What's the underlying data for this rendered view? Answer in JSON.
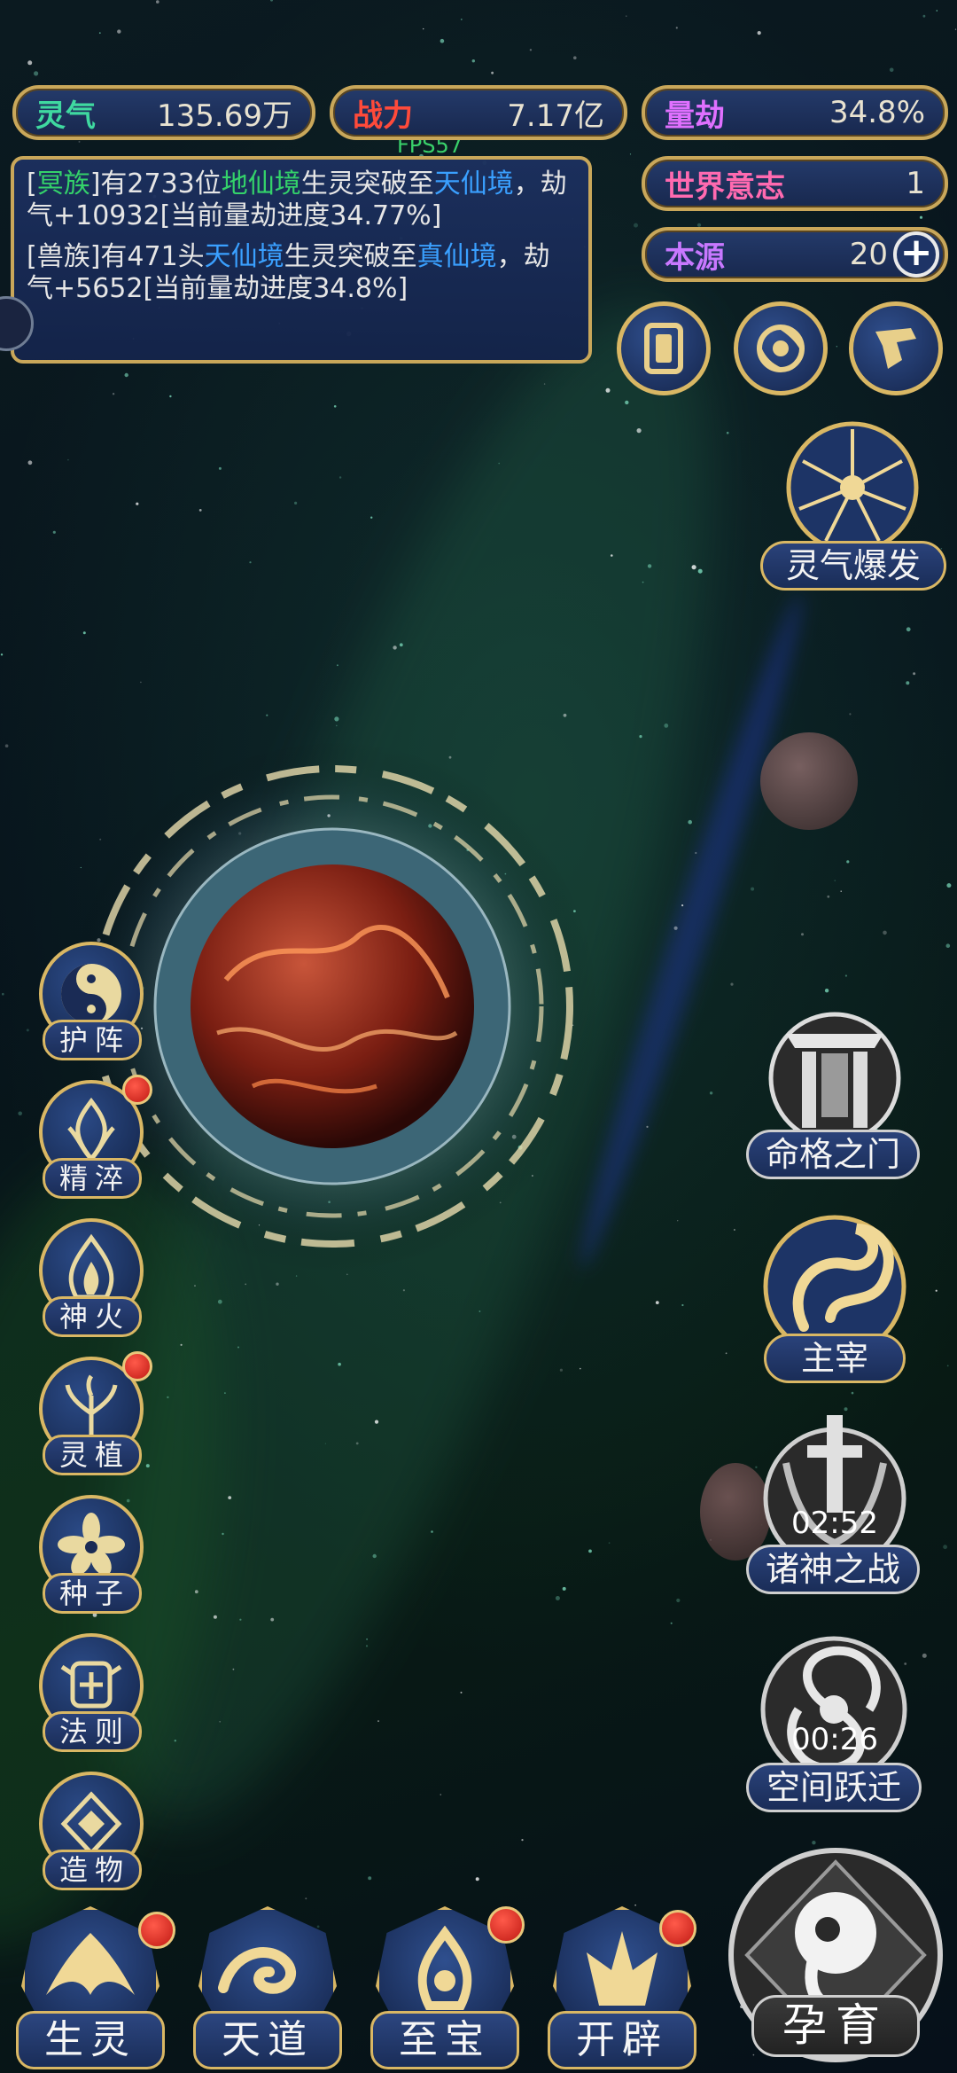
{
  "fps": "FPS57",
  "stats": {
    "lingqi": {
      "label": "灵气",
      "value": "135.69万"
    },
    "zhanli": {
      "label": "战力",
      "value": "7.17亿"
    },
    "liangjie": {
      "label": "量劫",
      "value": "34.8%"
    },
    "shijie": {
      "label": "世界意志",
      "value": "1"
    },
    "benyuan": {
      "label": "本源",
      "value": "20",
      "add": "+"
    }
  },
  "messages": [
    {
      "p1": "[",
      "race": "冥族",
      "p2": "]有2733位",
      "from": "地仙境",
      "p3": "生灵突破至",
      "to": "天仙境",
      "p4": "，劫气+10932[当前量劫进度34.77%]"
    },
    {
      "p1": "[兽族]有471头",
      "from": "天仙境",
      "p3": "生灵突破至",
      "to": "真仙境",
      "p4": "，劫气+5652[当前量劫进度34.8%]"
    }
  ],
  "side_menu": [
    {
      "label": "护阵",
      "icon": "yin-yang-icon",
      "badge": false
    },
    {
      "label": "精淬",
      "icon": "lotus-flame-icon",
      "badge": true
    },
    {
      "label": "神火",
      "icon": "flame-icon",
      "badge": false
    },
    {
      "label": "灵植",
      "icon": "plant-icon",
      "badge": true
    },
    {
      "label": "种子",
      "icon": "flower-icon",
      "badge": false
    },
    {
      "label": "法则",
      "icon": "rune-icon",
      "badge": false
    },
    {
      "label": "造物",
      "icon": "diamond-icon",
      "badge": false
    }
  ],
  "right_menu": {
    "burst": "灵气爆发",
    "fate_gate": "命格之门",
    "master": "主宰",
    "gods_war": "诸神之战",
    "gods_war_timer": "02:52",
    "space_jump": "空间跃迁",
    "space_jump_timer": "00:26"
  },
  "bottom_menu": [
    {
      "label": "生灵",
      "badge": true
    },
    {
      "label": "天道",
      "badge": false
    },
    {
      "label": "至宝",
      "badge": true
    },
    {
      "label": "开辟",
      "badge": true
    }
  ],
  "main_action": "孕育",
  "colors": {
    "gold": "#d9b764",
    "panel": "#1c305f",
    "green": "#34d26a",
    "blue": "#3aa0ff",
    "planet": "#8a2a1a"
  }
}
